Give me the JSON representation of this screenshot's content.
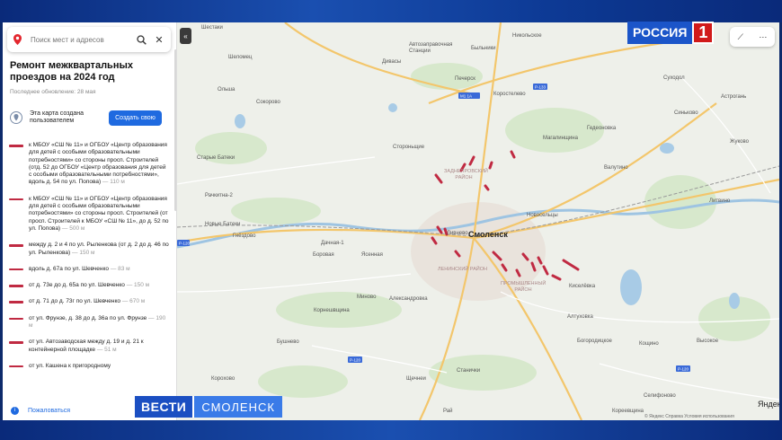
{
  "search": {
    "placeholder": "Поиск мест и адресов"
  },
  "sidebar": {
    "title": "Ремонт межквартальных проездов на 2024 год",
    "updated": "Последнее обновление: 28 мая",
    "creator_text": "Эта карта создана пользователем",
    "create_button": "Создать свою",
    "complain": "Пожаловаться",
    "routes": [
      {
        "text": "к МБОУ «СШ № 11» и ОГБОУ «Центр образования для детей с особыми образовательными потребностями» со стороны просп. Строителей (отд. 52 до ОГБОУ «Центр образования для детей с особыми образовательными потребностями», вдоль д. 54 по ул. Попова)",
        "len": "— 110 м"
      },
      {
        "text": "к МБОУ «СШ № 11» и ОГБОУ «Центр образования для детей с особыми образовательными потребностями» со стороны просп. Строителей (от просп. Строителей к МБОУ «СШ № 11», до д. 52 по ул. Попова)",
        "len": "— 500 м"
      },
      {
        "text": "между д. 2 и 4 по ул. Рыленкова (от д. 2 до д. 46 по ул. Рыленкова)",
        "len": "— 150 м"
      },
      {
        "text": "вдоль д. 67а по ул. Шевченко",
        "len": "— 83 м"
      },
      {
        "text": "от д. 73е до д. 65а по ул. Шевченко",
        "len": "— 150 м"
      },
      {
        "text": "от д. 71 до д. 73г по ул. Шевченко",
        "len": "— 670 м"
      },
      {
        "text": "от ул. Фрунзе, д. 38 до д. 36а по ул. Фрунзе",
        "len": "— 190 м"
      },
      {
        "text": "от ул. Автозаводская между д. 19 и д. 21 к контейнерной площадке",
        "len": "— 51 м"
      },
      {
        "text": "от ул. Кашена к пригородному",
        "len": ""
      }
    ]
  },
  "map": {
    "accent": "#c02a42",
    "city": "Смоленск",
    "labels": [
      "Шестаки",
      "Шеломец",
      "Дивасы",
      "Автозаправочная Станции",
      "Быльники",
      "Никольское",
      "Печерск",
      "Коростелево",
      "Ольша",
      "Сокорово",
      "Стороньщие",
      "Магалинщина",
      "Гедеоновка",
      "Суходол",
      "Синьково",
      "Астрогань",
      "Жуково",
      "Старые Батеки",
      "Рачкитна-2",
      "Новые Батеки",
      "Гнёздово",
      "Заднепровский район",
      "Новосельцы",
      "Валутино",
      "Литвино",
      "Дачная-1",
      "Боровая",
      "Ясенная",
      "Промышленный район",
      "Киселёвка",
      "Миново",
      "Александровка",
      "Корнешвщина",
      "Алтуховка",
      "Богородицкое",
      "Бушнево",
      "Станички",
      "Щечнеи",
      "Корохово",
      "Селифоново",
      "Кощино",
      "Высокое",
      "Рай",
      "Ленинский район",
      "Кореевщина",
      "Ливнево"
    ],
    "yandex": "Яндекс",
    "copyright": "© Яндекс  Справка  Условия использования"
  },
  "overlay": {
    "channel": "РОССИЯ",
    "channel_num": "1",
    "program": "ВЕСТИ",
    "region": "СМОЛЕНСК"
  }
}
